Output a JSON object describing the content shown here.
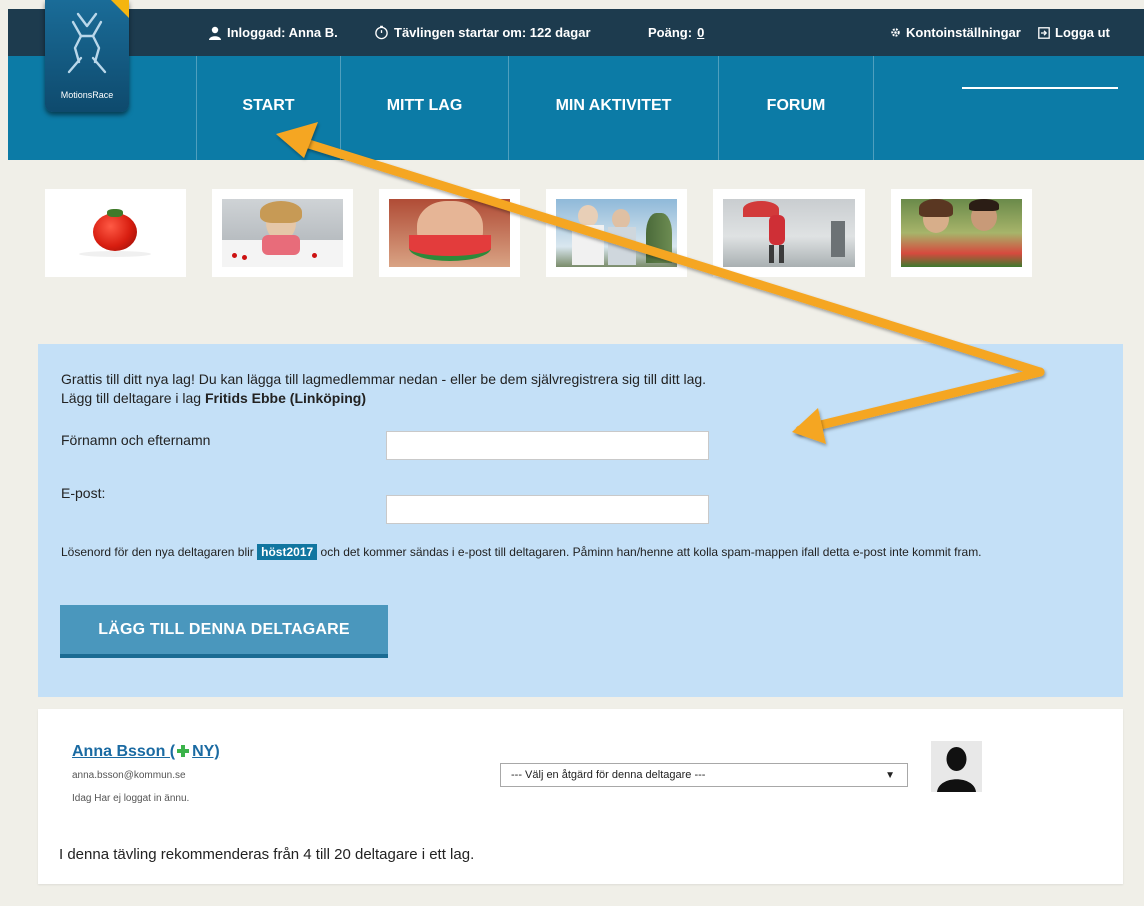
{
  "topbar": {
    "logged_in": "Inloggad: Anna B.",
    "countdown": "Tävlingen startar om: 122 dagar",
    "points_label": "Poäng:",
    "points_value": "0",
    "account_settings": "Kontoinställningar",
    "logout": "Logga ut"
  },
  "logo": {
    "text": "MotionsRace"
  },
  "nav": {
    "items": [
      {
        "label": "START"
      },
      {
        "label": "MITT LAG"
      },
      {
        "label": "MIN AKTIVITET"
      },
      {
        "label": "FORUM"
      }
    ]
  },
  "form": {
    "intro_line1": "Grattis till ditt nya lag! Du kan lägga till lagmedlemmar nedan - eller be dem självregistrera sig till ditt lag.",
    "intro_line2_prefix": "Lägg till deltagare i lag",
    "team_name": "Fritids Ebbe (Linköping)",
    "name_label": "Förnamn och efternamn",
    "name_value": "",
    "email_label": "E-post:",
    "email_value": "",
    "note_prefix": "Lösenord för den nya deltagaren blir",
    "password": "höst2017",
    "note_suffix": "och det kommer sändas i e-post till deltagaren. Påminn han/henne att kolla spam-mappen ifall detta e-post inte kommit fram.",
    "add_button": "LÄGG TILL DENNA DELTAGARE"
  },
  "member": {
    "name": "Anna Bsson (",
    "new_badge": "NY)",
    "email": "anna.bsson@kommun.se",
    "status": "Idag   Har ej loggat in ännu.",
    "action_select": "--- Välj en åtgärd för denna deltagare ---"
  },
  "recommendation": "I denna tävling rekommenderas från 4 till 20 deltagare i ett lag.",
  "colors": {
    "topbar": "#1d3b4e",
    "nav": "#0c7ba6",
    "panel": "#c4e0f7",
    "button": "#4a97bd",
    "annotation_arrow": "#f5a623"
  }
}
